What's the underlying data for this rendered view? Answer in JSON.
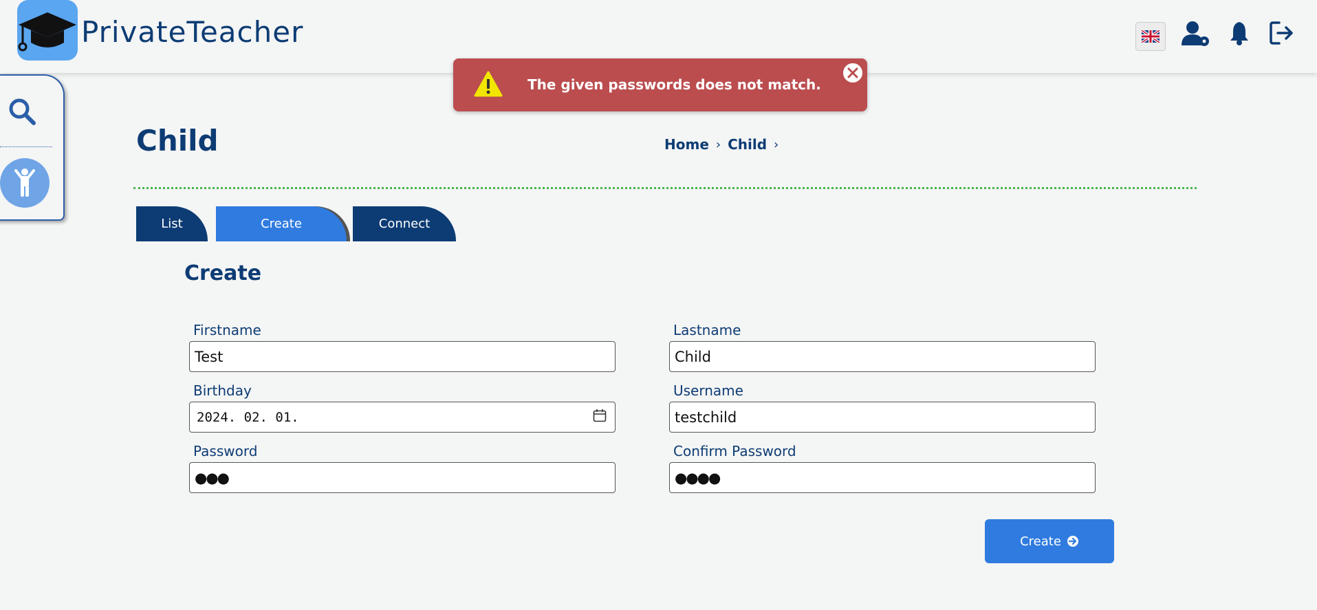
{
  "app": {
    "title": "PrivateTeacher"
  },
  "header": {
    "icons": [
      "language-flag-icon",
      "user-settings-icon",
      "bell-icon",
      "logout-icon"
    ]
  },
  "toast": {
    "message": "The given passwords does not match.",
    "color": "#bb4d4f",
    "icons": [
      "warning-icon",
      "close-icon"
    ]
  },
  "sidebar": {
    "icons": [
      "search-icon",
      "child-icon"
    ]
  },
  "page": {
    "title": "Child"
  },
  "breadcrumb": {
    "items": [
      "Home",
      "Child"
    ]
  },
  "tabs": [
    {
      "label": "List"
    },
    {
      "label": "Create",
      "active": true
    },
    {
      "label": "Connect"
    }
  ],
  "form": {
    "title": "Create",
    "firstname": {
      "label": "Firstname",
      "value": "Test"
    },
    "lastname": {
      "label": "Lastname",
      "value": "Child"
    },
    "birthday": {
      "label": "Birthday",
      "value": "2024. 02. 01."
    },
    "username": {
      "label": "Username",
      "value": "testchild"
    },
    "password": {
      "label": "Password",
      "value": "●●●"
    },
    "confirm_password": {
      "label": "Confirm Password",
      "value": "●●●●"
    },
    "submit_label": "Create"
  },
  "colors": {
    "primary_dark": "#0d3c74",
    "primary": "#2f7be0",
    "logo_bg": "#5aa6f0",
    "divider": "#49b54f"
  }
}
